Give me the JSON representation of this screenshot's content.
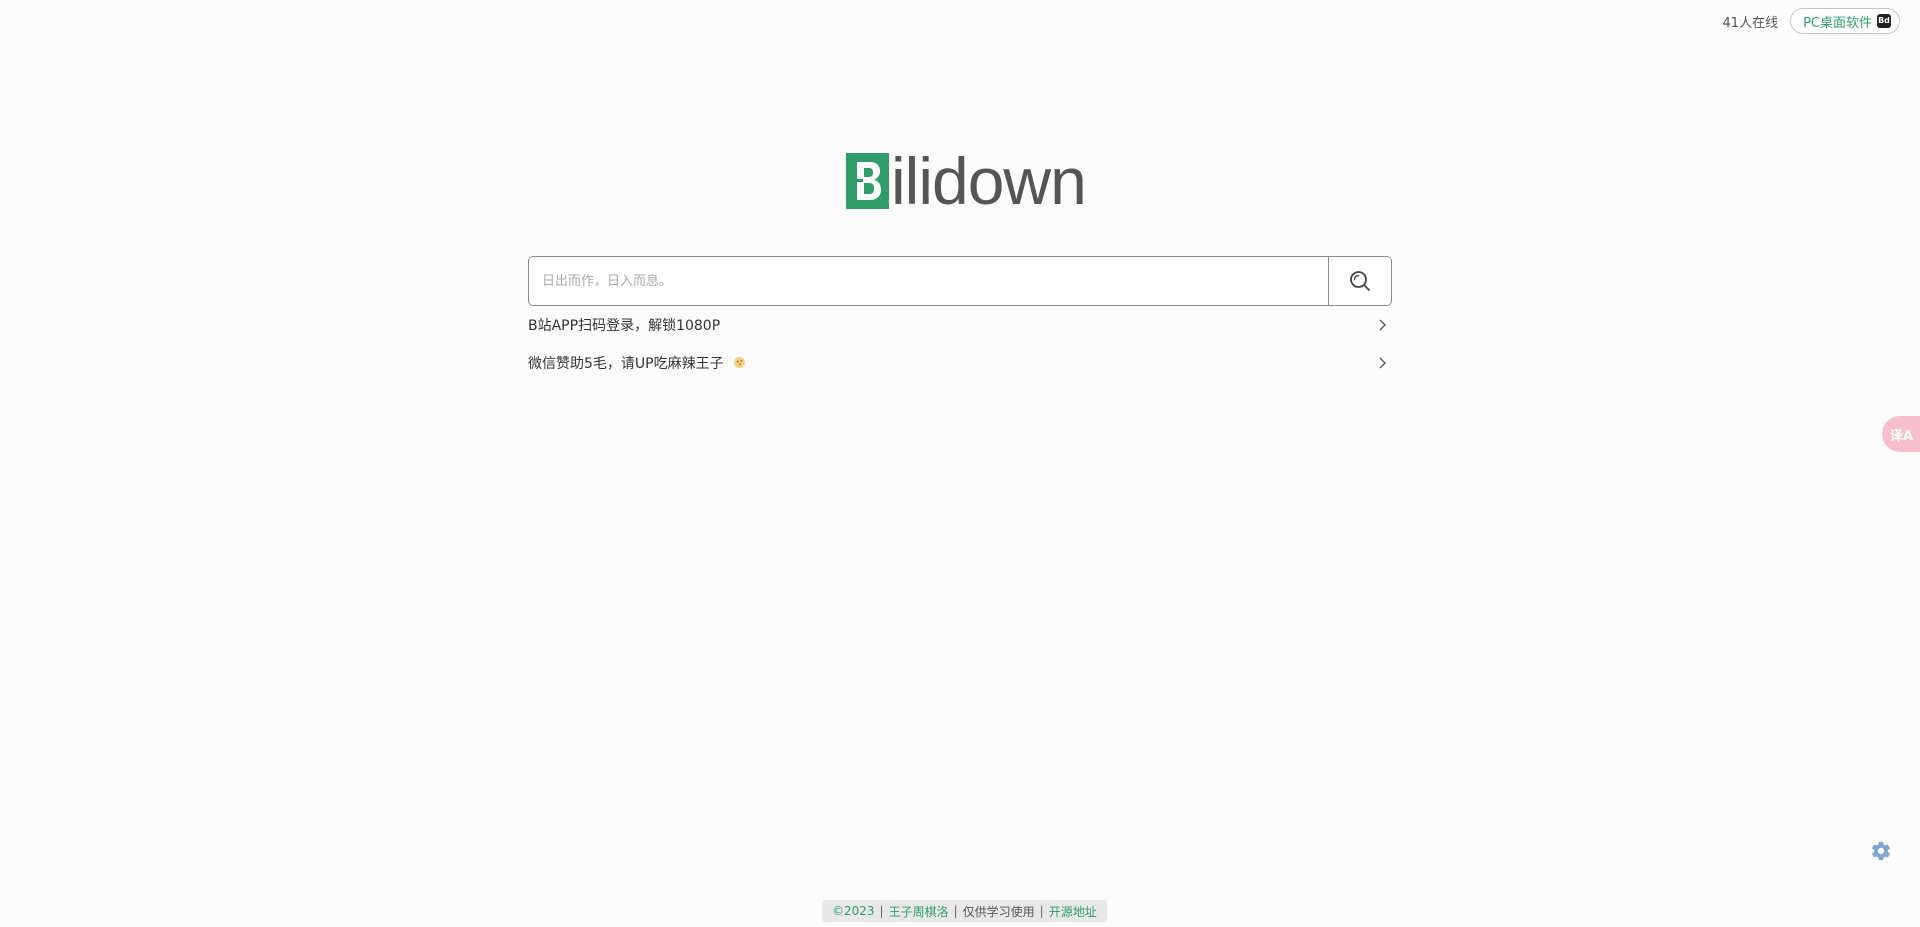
{
  "topbar": {
    "online_count": "41人在线",
    "pc_label": "PC桌面软件",
    "pc_icon_text": "Bd"
  },
  "logo": {
    "text": "ilidown",
    "letter": "B"
  },
  "search": {
    "placeholder": "日出而作，日入而息。",
    "value": "",
    "button_icon": "search-icon"
  },
  "links": [
    {
      "label": "B站APP扫码登录，解锁1080P"
    },
    {
      "label": "微信赞助5毛，请UP吃麻辣王子"
    }
  ],
  "translate": {
    "label": "译A"
  },
  "footer": {
    "copyright": "©2023",
    "author": "王子周棋洛",
    "notice": "仅供学习使用",
    "source": "开源地址",
    "separator": "|"
  },
  "colors": {
    "accent": "#2f9c6a",
    "translate_bg": "#f6bfcd",
    "gear": "#7ea6cf"
  }
}
